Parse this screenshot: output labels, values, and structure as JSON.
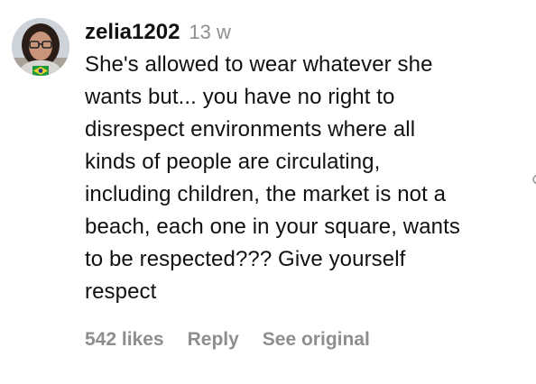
{
  "comment": {
    "username": "zelia1202",
    "time": "13 w",
    "text": "She's allowed to wear whatever she\nwants but... you have no right to\ndisrespect environments where all\nkinds of people are circulating,\nincluding children, the market is not a\nbeach, each one in your square, wants\nto be respected??? Give yourself\nrespect",
    "avatar_badge": "brazil-flag-icon"
  },
  "actions": {
    "likes": "542 likes",
    "reply": "Reply",
    "see_original": "See original"
  },
  "side": {
    "icon": "heart-outline-icon"
  }
}
